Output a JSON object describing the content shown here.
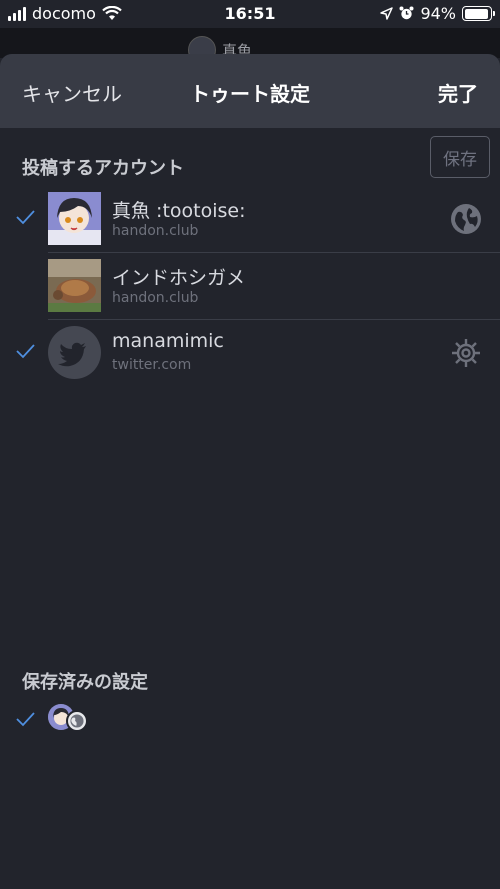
{
  "status_bar": {
    "carrier": "docomo",
    "time": "16:51",
    "battery": "94%",
    "battery_level": 0.94
  },
  "behind": {
    "title": "真魚"
  },
  "nav": {
    "cancel_label": "キャンセル",
    "title": "トゥート設定",
    "done_label": "完了"
  },
  "accounts_section": {
    "title": "投稿するアカウント",
    "save_label": "保存",
    "accounts": [
      {
        "name": "真魚 :tootoise:",
        "domain": "handon.club",
        "checked": true,
        "icon": "globe-icon"
      },
      {
        "name": "インドホシガメ",
        "domain": "handon.club",
        "checked": false,
        "icon": ""
      },
      {
        "name": "manamimic",
        "domain": "twitter.com",
        "checked": true,
        "icon": "gear-icon"
      }
    ]
  },
  "saved_section": {
    "title": "保存済みの設定"
  },
  "colors": {
    "accent": "#4f8fe0",
    "background": "#22242c",
    "nav_background": "#383b45"
  }
}
